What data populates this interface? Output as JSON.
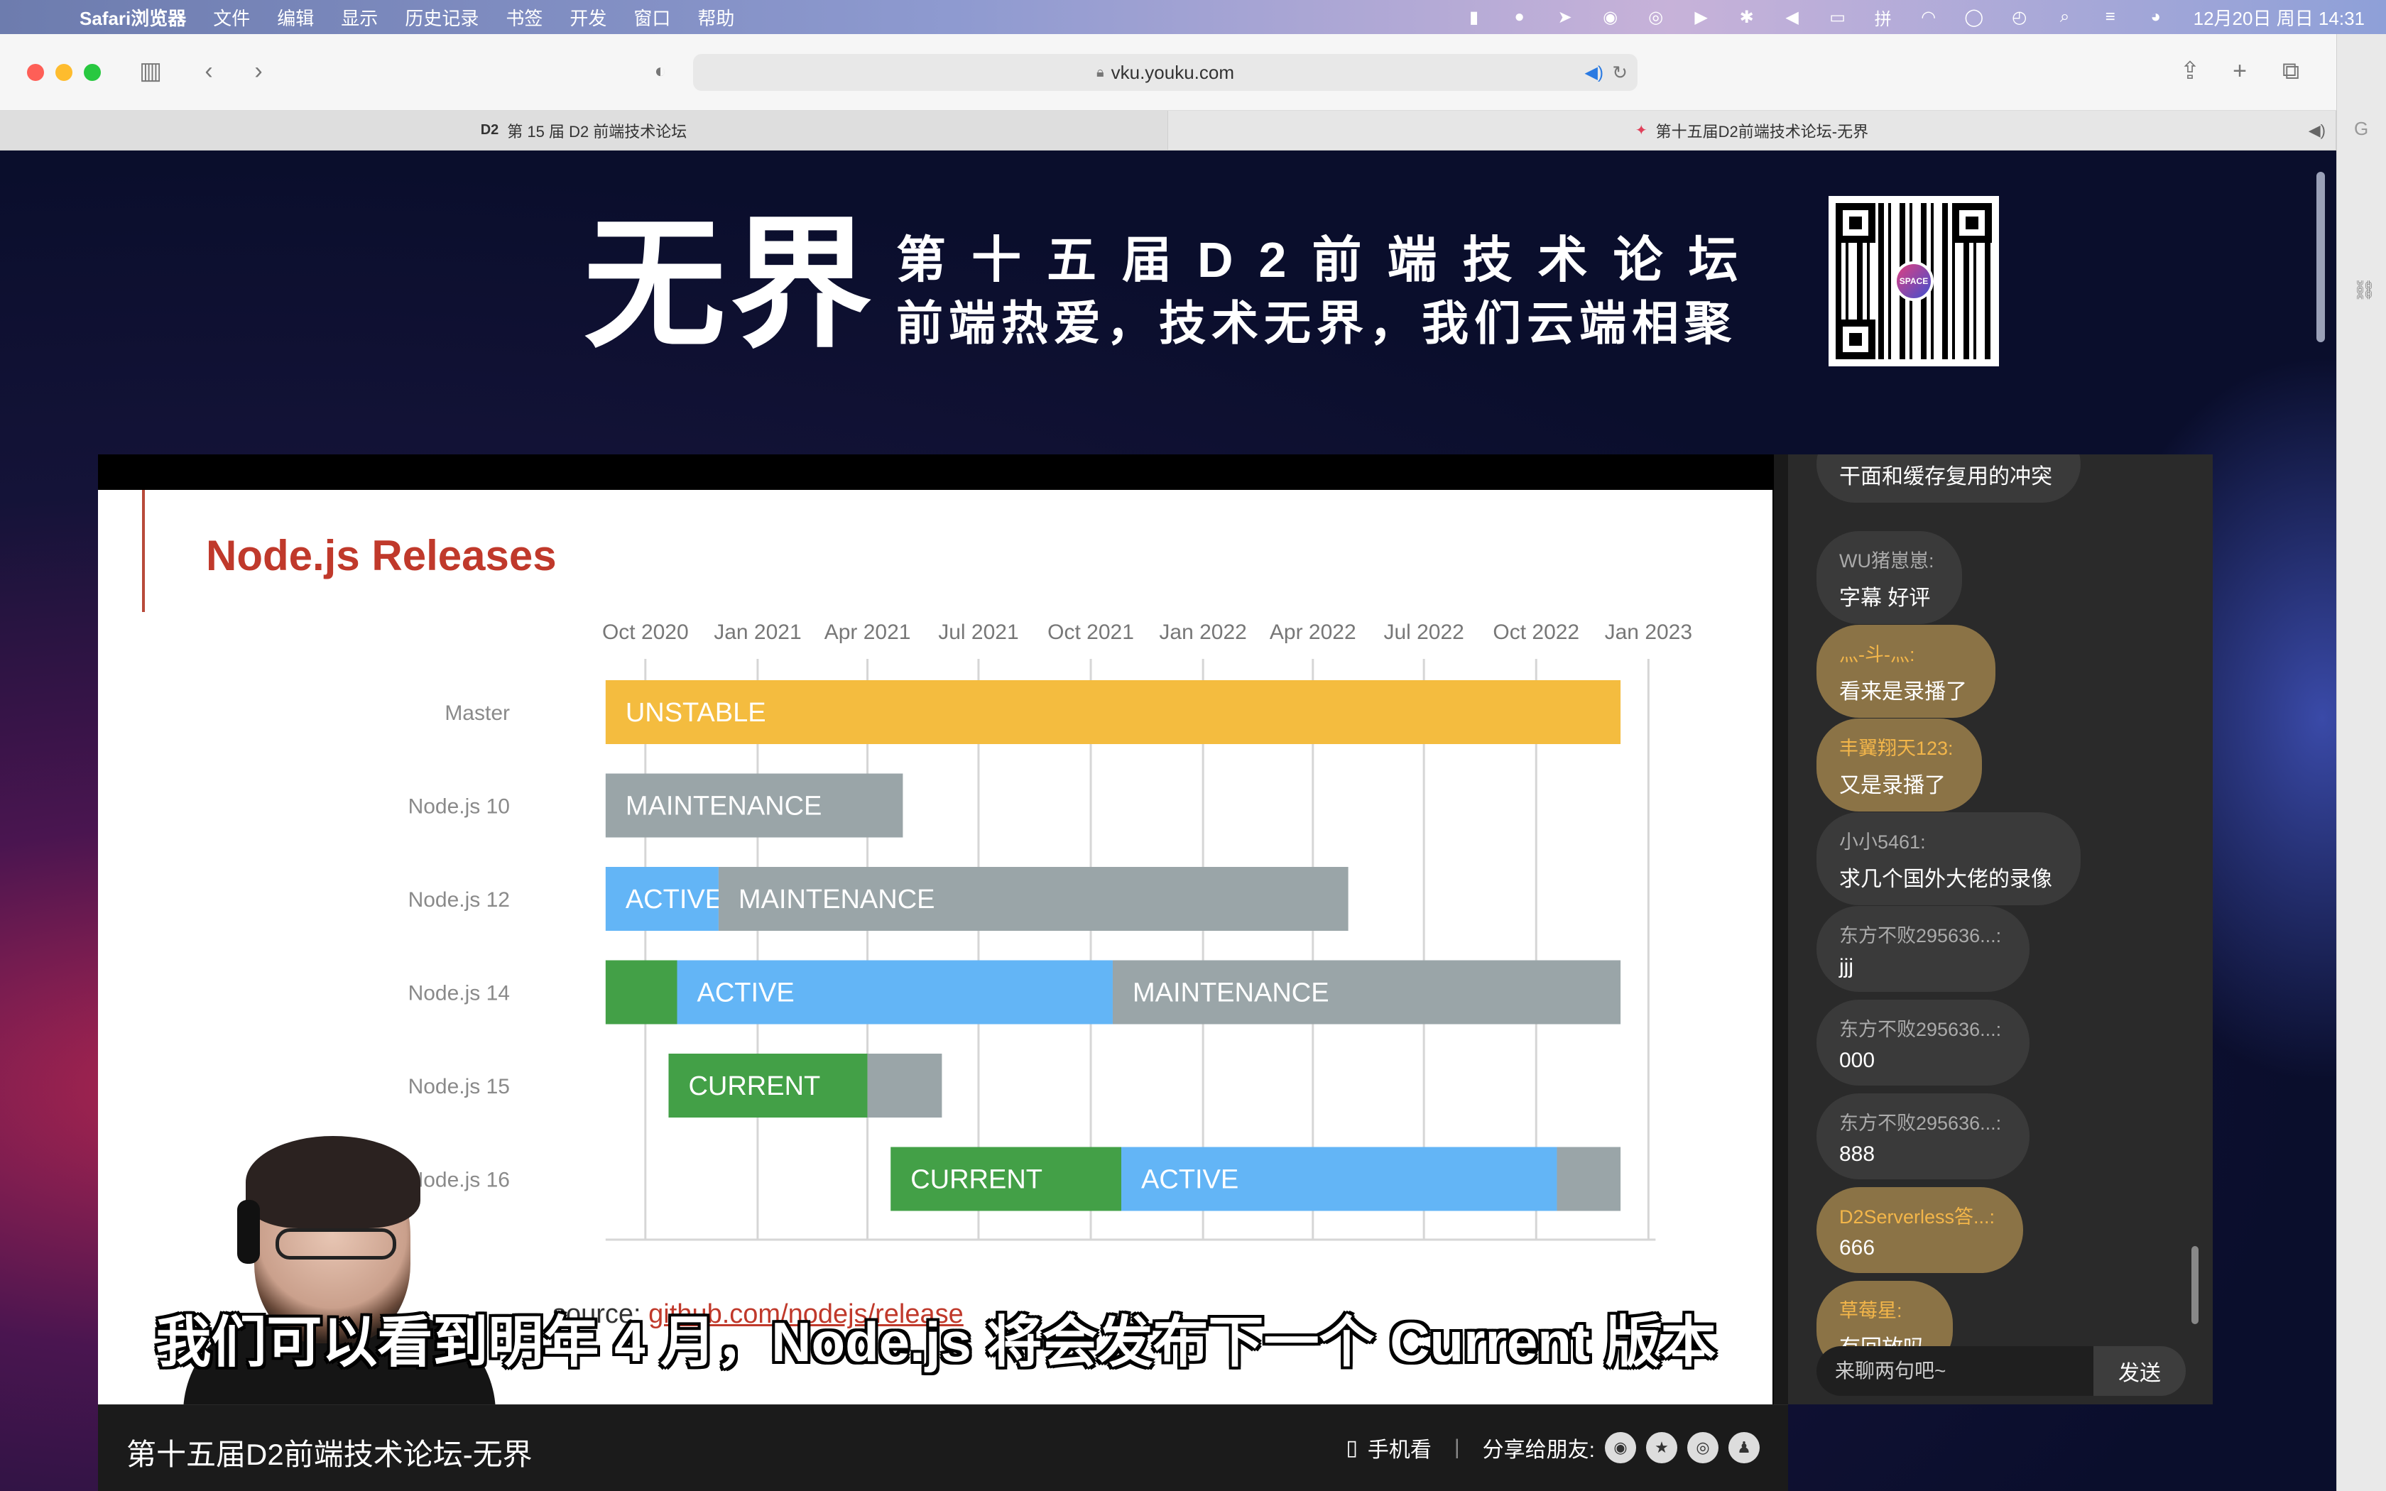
{
  "menubar": {
    "app": "Safari浏览器",
    "items": [
      "文件",
      "编辑",
      "显示",
      "历史记录",
      "书签",
      "开发",
      "窗口",
      "帮助"
    ],
    "clock": "12月20日 周日  14:31"
  },
  "browser": {
    "url": "vku.youku.com",
    "tabs": [
      {
        "favicon": "D2",
        "title": "第 15 届 D2 前端技术论坛"
      },
      {
        "favicon": "✦",
        "title": "第十五届D2前端技术论坛-无界"
      }
    ],
    "right_strip_letter": "G"
  },
  "banner": {
    "logo": "无界",
    "line1": "第十五届D2前端技术论坛",
    "line2": "前端热爱，技术无界，我们云端相聚",
    "qr_label": "SPACE"
  },
  "slide": {
    "title": "Node.js Releases",
    "source_prefix": "source: ",
    "source_link": "github.com/nodejs/release"
  },
  "chart_data": {
    "type": "bar",
    "title": "Node.js Releases",
    "x_ticks": [
      "Oct 2020",
      "Jan 2021",
      "Apr 2021",
      "Jul 2021",
      "Oct 2021",
      "Jan 2022",
      "Apr 2022",
      "Jul 2022",
      "Oct 2022",
      "Jan 2023"
    ],
    "rows": [
      {
        "name": "Master",
        "segments": [
          {
            "label": "UNSTABLE",
            "start": "2020-10",
            "end": "2022-12",
            "color": "#f4bc3f"
          }
        ]
      },
      {
        "name": "Node.js 10",
        "segments": [
          {
            "label": "MAINTENANCE",
            "start": "2020-10",
            "end": "2021-04-30",
            "color": "#9aa5a8"
          }
        ]
      },
      {
        "name": "Node.js 12",
        "segments": [
          {
            "label": "ACTIVE",
            "start": "2020-10",
            "end": "2020-11-30",
            "color": "#63b5f6"
          },
          {
            "label": "MAINTENANCE",
            "start": "2020-11-30",
            "end": "2022-04-30",
            "color": "#9aa5a8"
          }
        ]
      },
      {
        "name": "Node.js 14",
        "segments": [
          {
            "label": "",
            "start": "2020-10",
            "end": "2020-10-27",
            "color": "#43a047"
          },
          {
            "label": "ACTIVE",
            "start": "2020-10-27",
            "end": "2021-10-19",
            "color": "#63b5f6"
          },
          {
            "label": "MAINTENANCE",
            "start": "2021-10-19",
            "end": "2022-12",
            "color": "#9aa5a8"
          }
        ]
      },
      {
        "name": "Node.js 15",
        "segments": [
          {
            "label": "CURRENT",
            "start": "2020-10-20",
            "end": "2021-04-01",
            "color": "#43a047"
          },
          {
            "label": "",
            "start": "2021-04-01",
            "end": "2021-06-01",
            "color": "#9aa5a8"
          }
        ]
      },
      {
        "name": "Node.js 16",
        "segments": [
          {
            "label": "CURRENT",
            "start": "2021-04-20",
            "end": "2021-10-26",
            "color": "#43a047"
          },
          {
            "label": "ACTIVE",
            "start": "2021-10-26",
            "end": "2022-10-18",
            "color": "#63b5f6"
          },
          {
            "label": "",
            "start": "2022-10-18",
            "end": "2022-12",
            "color": "#9aa5a8"
          }
        ]
      }
    ],
    "grid": true
  },
  "video": {
    "subtitle": "我们可以看到明年 4 月，Node.js 将会发布下一个 Current 版本"
  },
  "chat": {
    "top_partial": "干面和缓存复用的冲突",
    "messages": [
      {
        "name": "WU猪崽崽:",
        "text": "字幕 好评",
        "gold": false
      },
      {
        "name": "灬-斗-灬:",
        "text": "看来是录播了",
        "gold": true
      },
      {
        "name": "丰翼翔天123:",
        "text": "又是录播了",
        "gold": true
      },
      {
        "name": "小小5461:",
        "text": "求几个国外大佬的录像",
        "gold": false
      },
      {
        "name": "东方不败295636...:",
        "text": "jjj",
        "gold": false
      },
      {
        "name": "东方不败295636...:",
        "text": "000",
        "gold": false
      },
      {
        "name": "东方不败295636...:",
        "text": "888",
        "gold": false
      },
      {
        "name": "D2Serverless答...:",
        "text": "666",
        "gold": true
      },
      {
        "name": "草莓星:",
        "text": "有回放吗",
        "gold": true
      }
    ],
    "input_placeholder": "来聊两句吧~",
    "send_label": "发送"
  },
  "bottombar": {
    "title": "第十五届D2前端技术论坛-无界",
    "mobile_label": "手机看",
    "separator": "|",
    "share_label": "分享给朋友:"
  }
}
